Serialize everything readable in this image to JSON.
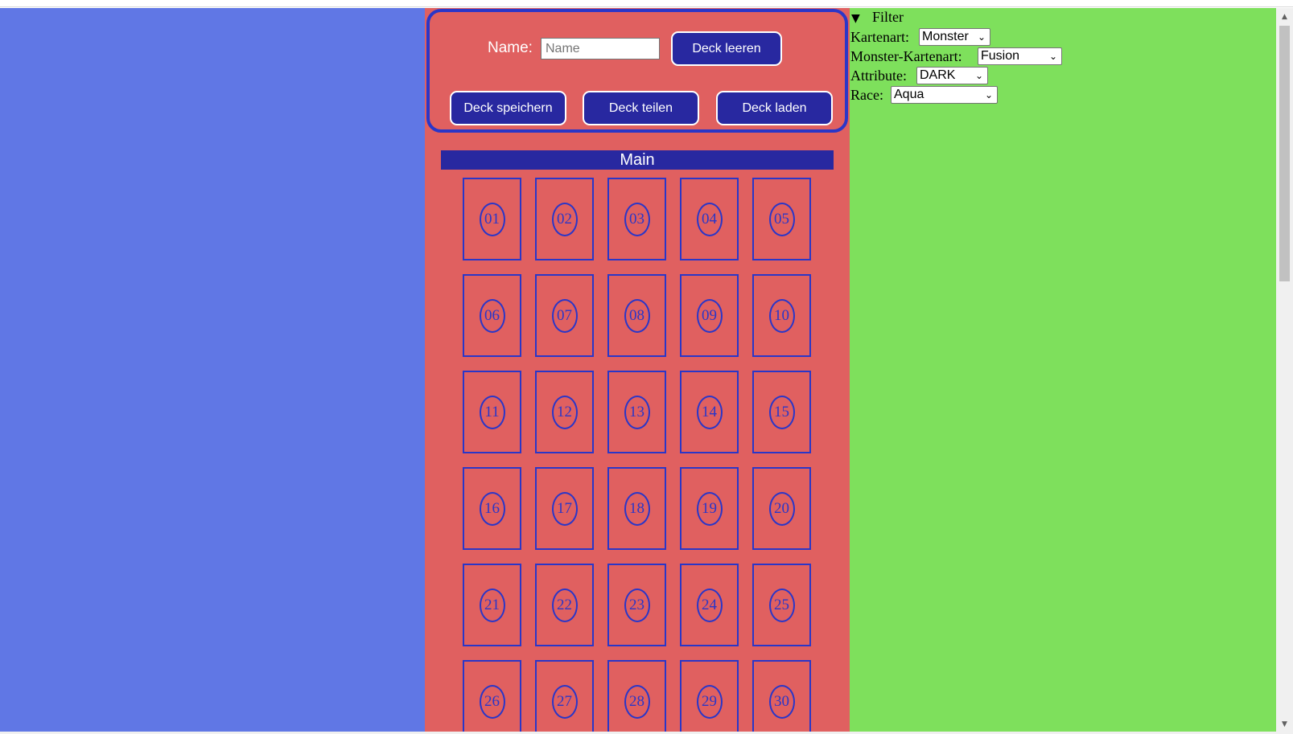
{
  "deck": {
    "name_label": "Name:",
    "name_placeholder": "Name",
    "name_value": "",
    "clear_button": "Deck leeren",
    "save_button": "Deck speichern",
    "share_button": "Deck teilen",
    "load_button": "Deck laden"
  },
  "main": {
    "header": "Main",
    "slots": [
      "01",
      "02",
      "03",
      "04",
      "05",
      "06",
      "07",
      "08",
      "09",
      "10",
      "11",
      "12",
      "13",
      "14",
      "15",
      "16",
      "17",
      "18",
      "19",
      "20",
      "21",
      "22",
      "23",
      "24",
      "25",
      "26",
      "27",
      "28",
      "29",
      "30"
    ]
  },
  "filter": {
    "summary": "Filter",
    "triangle_icon": "triangle-down-icon",
    "card_type": {
      "label": "Kartenart:",
      "value": "Monster"
    },
    "monster_card_type": {
      "label": "Monster-Kartenart:",
      "value": "Fusion"
    },
    "attribute": {
      "label": "Attribute:",
      "value": "DARK"
    },
    "race": {
      "label": "Race:",
      "value": "Aqua"
    }
  },
  "colors": {
    "left_panel": "#6077e5",
    "center_panel": "#e06060",
    "right_panel": "#7ee05c",
    "accent_blue": "#2828a0",
    "outline_blue": "#2a36c8"
  }
}
